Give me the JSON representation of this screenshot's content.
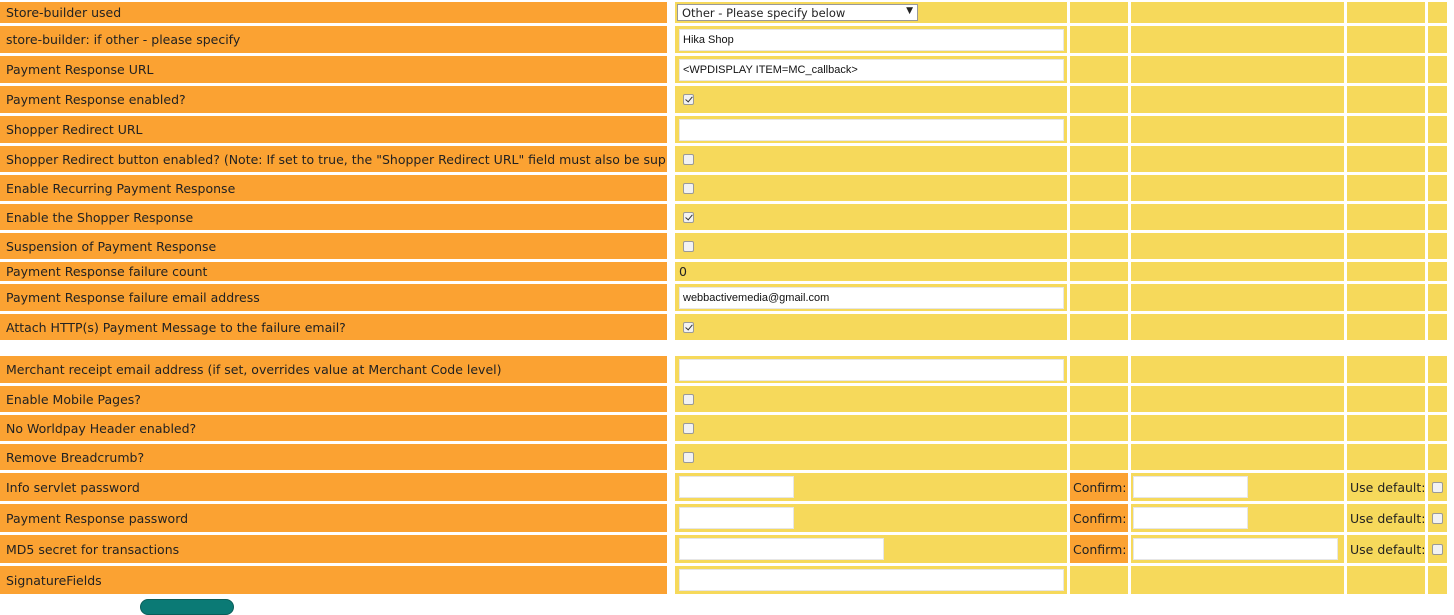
{
  "rows": [
    {
      "label": "Store-builder used"
    },
    {
      "label": "store-builder: if other - please specify",
      "value": "Hika Shop"
    },
    {
      "label": "Payment Response URL",
      "value": "<WPDISPLAY ITEM=MC_callback>"
    },
    {
      "label": "Payment Response enabled?",
      "checked": true
    },
    {
      "label": "Shopper Redirect URL",
      "value": ""
    },
    {
      "label": "Shopper Redirect button enabled? (Note: If set to true, the \"Shopper Redirect URL\" field must also be supplied)",
      "checked": false
    },
    {
      "label": "Enable Recurring Payment Response",
      "checked": false
    },
    {
      "label": "Enable the Shopper Response",
      "checked": true
    },
    {
      "label": "Suspension of Payment Response",
      "checked": false
    },
    {
      "label": "Payment Response failure count",
      "value": "0"
    },
    {
      "label": "Payment Response failure email address",
      "value": "webbactivemedia@gmail.com"
    },
    {
      "label": "Attach HTTP(s) Payment Message to the failure email?",
      "checked": true
    },
    {
      "label": "Merchant receipt email address (if set, overrides value at Merchant Code level)",
      "value": ""
    },
    {
      "label": "Enable Mobile Pages?",
      "checked": false
    },
    {
      "label": "No Worldpay Header enabled?",
      "checked": false
    },
    {
      "label": "Remove Breadcrumb?",
      "checked": false
    },
    {
      "label": "Info servlet password",
      "value": "",
      "confirm_label": "Confirm:",
      "use_default_label": "Use default:",
      "use_default_checked": false
    },
    {
      "label": "Payment Response password",
      "value": "",
      "confirm_label": "Confirm:",
      "use_default_label": "Use default:",
      "use_default_checked": false
    },
    {
      "label": "MD5 secret for transactions",
      "value": "",
      "confirm_label": "Confirm:",
      "use_default_label": "Use default:",
      "use_default_checked": false
    },
    {
      "label": "SignatureFields",
      "value": ""
    }
  ],
  "store_builder_select": {
    "selected": "Other - Please specify below"
  },
  "colors": {
    "label_bg": "#FBA232",
    "field_bg": "#F6D95B",
    "input_bg": "#FFFFFF"
  }
}
